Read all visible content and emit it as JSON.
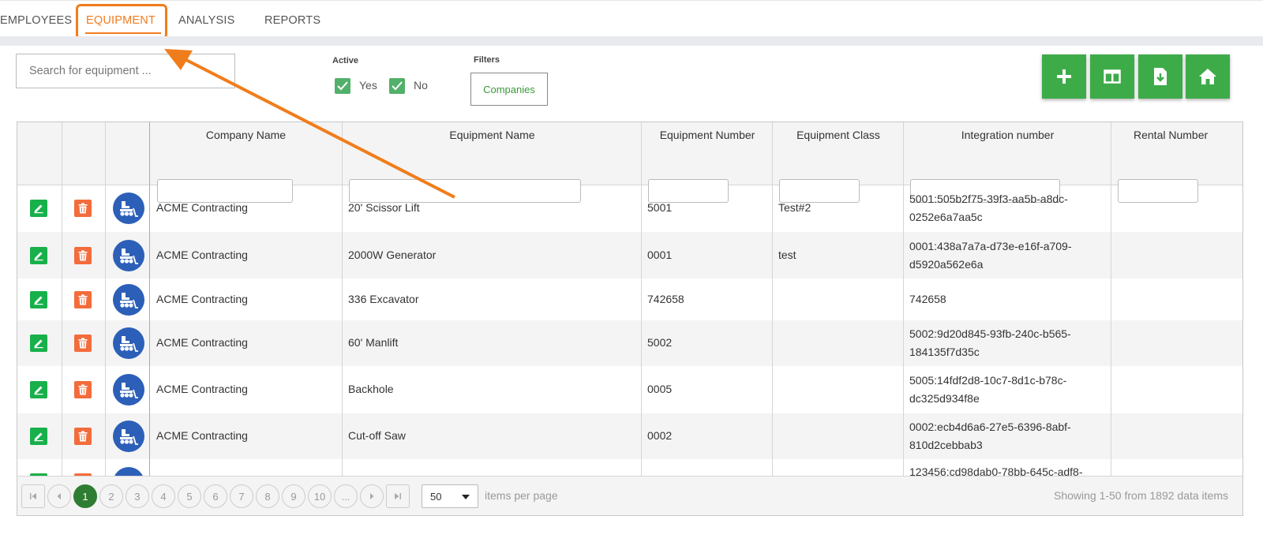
{
  "nav": {
    "tabs": [
      {
        "label": "EMPLOYEES"
      },
      {
        "label": "EQUIPMENT"
      },
      {
        "label": "ANALYSIS"
      },
      {
        "label": "REPORTS"
      }
    ]
  },
  "toolbar": {
    "search_placeholder": "Search for equipment ...",
    "active_label": "Active",
    "yes_label": "Yes",
    "no_label": "No",
    "filters_label": "Filters",
    "companies_label": "Companies",
    "buttons": [
      "plus-icon",
      "columns-icon",
      "download-file-icon",
      "home-icon"
    ]
  },
  "table": {
    "columns": [
      "Company Name",
      "Equipment Name",
      "Equipment Number",
      "Equipment Class",
      "Integration number",
      "Rental Number"
    ],
    "rows": [
      {
        "company": "ACME Contracting",
        "name": "20' Scissor Lift",
        "number": "5001",
        "class": "Test#2",
        "integration_1": "5001:505b2f75-39f3-aa5b-a8dc-",
        "integration_2": "0252e6a7aa5c"
      },
      {
        "company": "ACME Contracting",
        "name": "2000W Generator",
        "number": "0001",
        "class": "test",
        "integration_1": "0001:438a7a7a-d73e-e16f-a709-",
        "integration_2": "d5920a562e6a"
      },
      {
        "company": "ACME Contracting",
        "name": "336 Excavator",
        "number": "742658",
        "class": "",
        "integration_1": "742658",
        "integration_2": ""
      },
      {
        "company": "ACME Contracting",
        "name": "60' Manlift",
        "number": "5002",
        "class": "",
        "integration_1": "5002:9d20d845-93fb-240c-b565-",
        "integration_2": "184135f7d35c"
      },
      {
        "company": "ACME Contracting",
        "name": "Backhole",
        "number": "0005",
        "class": "",
        "integration_1": "5005:14fdf2d8-10c7-8d1c-b78c-",
        "integration_2": "dc325d934f8e"
      },
      {
        "company": "ACME Contracting",
        "name": "Cut-off Saw",
        "number": "0002",
        "class": "",
        "integration_1": "0002:ecb4d6a6-27e5-6396-8abf-",
        "integration_2": "810d2cebbab3"
      },
      {
        "company": "",
        "name": "",
        "number": "",
        "class": "",
        "integration_1": "123456:cd98dab0-78bb-645c-adf8-",
        "integration_2": ""
      }
    ]
  },
  "pager": {
    "pages": [
      "1",
      "2",
      "3",
      "4",
      "5",
      "6",
      "7",
      "8",
      "9",
      "10",
      "..."
    ],
    "current_page": "1",
    "page_size": "50",
    "items_per_page_label": "items per page",
    "summary": "Showing 1-50 from 1892 data items"
  },
  "colors": {
    "accent_orange": "#f27b1f",
    "button_green": "#3eab49",
    "edit_green": "#18b04b",
    "delete_orange": "#f36c3c",
    "equipment_blue": "#2c5fb8"
  }
}
